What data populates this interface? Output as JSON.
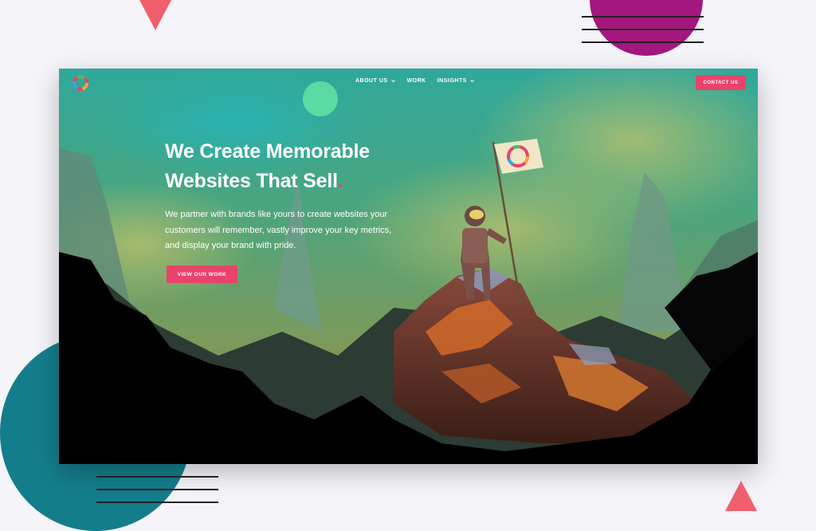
{
  "nav": {
    "items": [
      {
        "label": "ABOUT US",
        "has_dropdown": true
      },
      {
        "label": "WORK",
        "has_dropdown": false
      },
      {
        "label": "INSIGHTS",
        "has_dropdown": true
      }
    ],
    "contact_label": "CONTACT US"
  },
  "hero": {
    "title_line1": "We Create Memorable",
    "title_line2": "Websites That Sell",
    "title_dot": ".",
    "body_line1": "We partner with brands like yours to create websites your",
    "body_line2": "customers will remember, vastly improve your key metrics,",
    "body_line3": "and display your brand with pride.",
    "cta_label": "VIEW OUR WORK"
  },
  "colors": {
    "accent": "#e8436b",
    "deco_purple": "#a3177f",
    "deco_teal": "#147d8b",
    "deco_coral": "#f0606c",
    "page_bg": "#f4f4f9"
  },
  "icons": {
    "logo": "multicolor-ring-logo",
    "chevron": "chevron-down-icon"
  }
}
